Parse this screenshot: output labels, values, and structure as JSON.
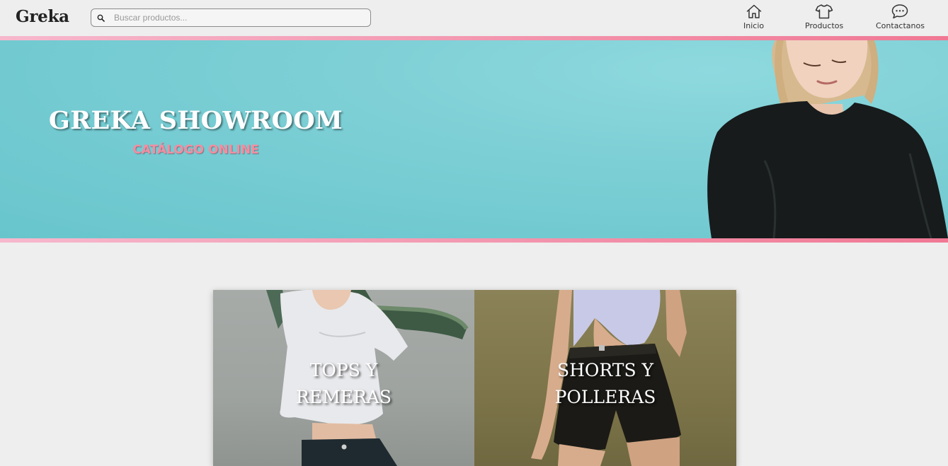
{
  "header": {
    "logo": "Greka",
    "search": {
      "placeholder": "Buscar productos..."
    },
    "nav": [
      {
        "label": "Inicio",
        "icon": "home-icon"
      },
      {
        "label": "Productos",
        "icon": "tshirt-icon"
      },
      {
        "label": "Contactanos",
        "icon": "chat-icon"
      }
    ]
  },
  "hero": {
    "title": "GREKA SHOWROOM",
    "subtitle": "CATÁLOGO ONLINE"
  },
  "categories": [
    {
      "line1": "TOPS Y",
      "line2": "REMERAS"
    },
    {
      "line1": "SHORTS Y",
      "line2": "POLLERAS"
    }
  ],
  "colors": {
    "hero_bg": "#7ccfd5",
    "accent_pink": "#f07894",
    "subtitle_pink": "#f48da0",
    "page_bg": "#eeeeee"
  }
}
